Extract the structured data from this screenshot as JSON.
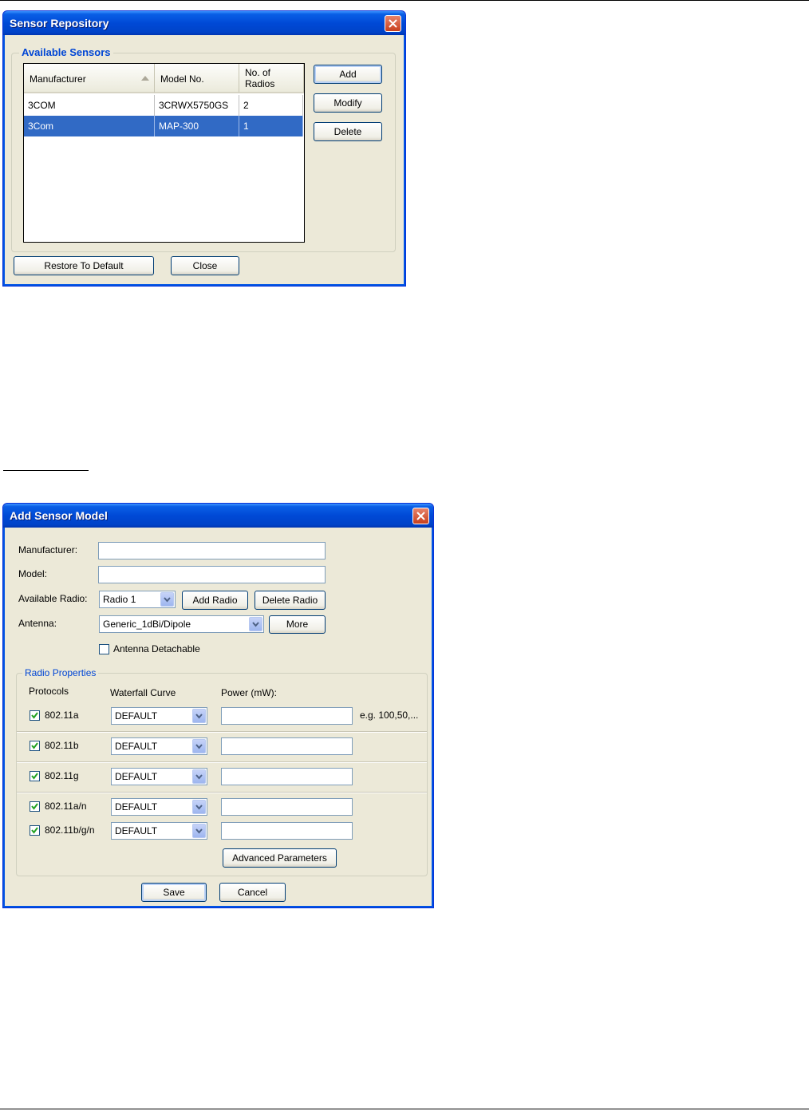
{
  "sensor_repository": {
    "title": "Sensor Repository",
    "group_label": "Available Sensors",
    "columns": [
      "Manufacturer",
      "Model No.",
      "No. of\nRadios"
    ],
    "rows": [
      {
        "manufacturer": "3COM",
        "model": "3CRWX5750GS",
        "radios": "2",
        "selected": false
      },
      {
        "manufacturer": "3Com",
        "model": "MAP-300",
        "radios": "1",
        "selected": true
      }
    ],
    "buttons": {
      "add": "Add",
      "modify": "Modify",
      "delete": "Delete",
      "restore": "Restore To Default",
      "close": "Close"
    }
  },
  "add_sensor_model": {
    "title": "Add Sensor Model",
    "labels": {
      "manufacturer": "Manufacturer:",
      "model": "Model:",
      "available_radio": "Available Radio:",
      "antenna": "Antenna:"
    },
    "values": {
      "manufacturer": "",
      "model": "",
      "radio": "Radio 1",
      "antenna": "Generic_1dBi/Dipole"
    },
    "buttons": {
      "add_radio": "Add Radio",
      "delete_radio": "Delete Radio",
      "more": "More",
      "advanced": "Advanced Parameters",
      "save": "Save",
      "cancel": "Cancel"
    },
    "antenna_detachable": {
      "label": "Antenna Detachable",
      "checked": false
    },
    "radio_properties": {
      "label": "Radio Properties",
      "headers": {
        "protocols": "Protocols",
        "waterfall": "Waterfall Curve",
        "power": "Power (mW):"
      },
      "hint": "e.g. 100,50,...",
      "protocols": [
        {
          "name": "802.11a",
          "checked": true,
          "curve": "DEFAULT",
          "power": ""
        },
        {
          "name": "802.11b",
          "checked": true,
          "curve": "DEFAULT",
          "power": ""
        },
        {
          "name": "802.11g",
          "checked": true,
          "curve": "DEFAULT",
          "power": ""
        },
        {
          "name": "802.11a/n",
          "checked": true,
          "curve": "DEFAULT",
          "power": ""
        },
        {
          "name": "802.11b/g/n",
          "checked": true,
          "curve": "DEFAULT",
          "power": ""
        }
      ]
    }
  },
  "colors": {
    "titlebar": "#0049d6",
    "window_bg": "#ece9d8",
    "selection": "#316ac5",
    "group_label": "#0046d5"
  }
}
